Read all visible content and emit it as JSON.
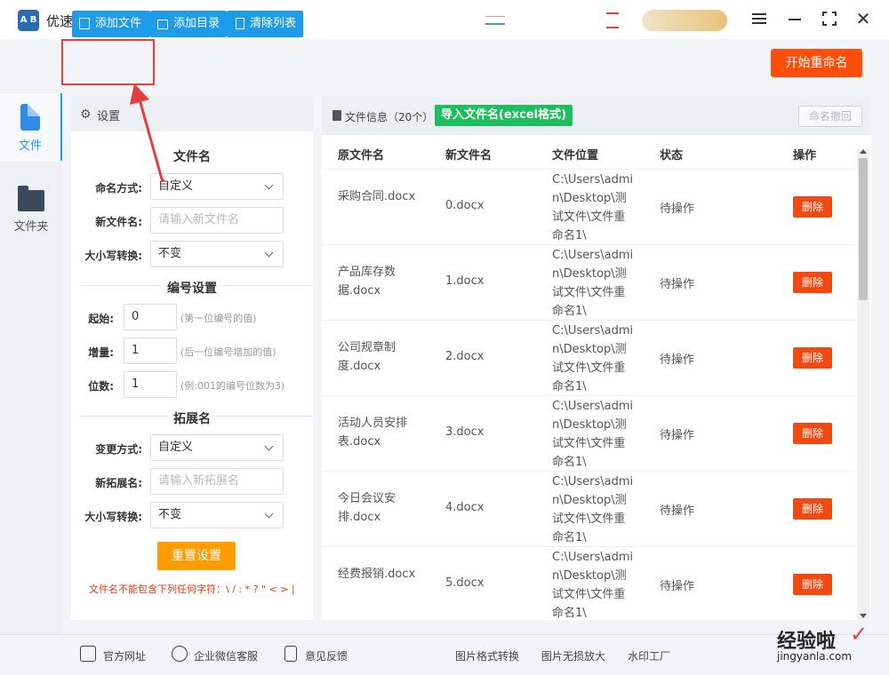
{
  "app": {
    "logo_text": "A B",
    "title": "优速文件批量重命名"
  },
  "toolbar": {
    "add_file": "添加文件",
    "add_dir": "添加目录",
    "clear_list": "清除列表",
    "start": "开始重命名"
  },
  "nav": {
    "file": "文件",
    "folder": "文件夹"
  },
  "settings": {
    "title": "设置",
    "filename_section": "文件名",
    "naming_mode_label": "命名方式:",
    "naming_mode_value": "自定义",
    "new_name_label": "新文件名:",
    "new_name_placeholder": "请输入新文件名",
    "case_label": "大小写转换:",
    "case_value": "不变",
    "numbering_section": "编号设置",
    "start_label": "起始:",
    "start_value": "0",
    "start_hint": "(第一位编号的值)",
    "step_label": "增量:",
    "step_value": "1",
    "step_hint": "(后一位编号增加的值)",
    "digits_label": "位数:",
    "digits_value": "1",
    "digits_hint": "(例:001的编号位数为3)",
    "ext_section": "拓展名",
    "ext_mode_label": "变更方式:",
    "ext_mode_value": "自定义",
    "new_ext_label": "新拓展名:",
    "new_ext_placeholder": "请输入新拓展名",
    "ext_case_label": "大小写转换:",
    "ext_case_value": "不变",
    "reset": "重置设置",
    "warning": "文件名不能包含下列任何字符：\\ / : * ? \" < > |"
  },
  "files": {
    "title": "文件信息（20个）",
    "import_btn": "导入文件名(excel格式)",
    "undo_btn": "命名撤回",
    "columns": {
      "orig": "原文件名",
      "new": "新文件名",
      "loc": "文件位置",
      "status": "状态",
      "action": "操作"
    },
    "rows": [
      {
        "orig": "采购合同.docx",
        "new": "0.docx",
        "loc": "C:\\Users\\admin\\Desktop\\测试文件\\文件重命名1\\",
        "status": "待操作",
        "action": "删除"
      },
      {
        "orig": "产品库存数据.docx",
        "new": "1.docx",
        "loc": "C:\\Users\\admin\\Desktop\\测试文件\\文件重命名1\\",
        "status": "待操作",
        "action": "删除"
      },
      {
        "orig": "公司规章制度.docx",
        "new": "2.docx",
        "loc": "C:\\Users\\admin\\Desktop\\测试文件\\文件重命名1\\",
        "status": "待操作",
        "action": "删除"
      },
      {
        "orig": "活动人员安排表.docx",
        "new": "3.docx",
        "loc": "C:\\Users\\admin\\Desktop\\测试文件\\文件重命名1\\",
        "status": "待操作",
        "action": "删除"
      },
      {
        "orig": "今日会议安排.docx",
        "new": "4.docx",
        "loc": "C:\\Users\\admin\\Desktop\\测试文件\\文件重命名1\\",
        "status": "待操作",
        "action": "删除"
      },
      {
        "orig": "经费报销.docx",
        "new": "5.docx",
        "loc": "C:\\Users\\admin\\Desktop\\测试文件\\文件重命名1\\",
        "status": "待操作",
        "action": "删除"
      }
    ]
  },
  "footer": {
    "website": "官方网址",
    "wechat": "企业微信客服",
    "feedback": "意见反馈",
    "img_convert": "图片格式转换",
    "img_enlarge": "图片无损放大",
    "watermark_factory": "水印工厂"
  },
  "watermark": {
    "main": "经验啦",
    "sub": "jingyanla.com"
  },
  "colors": {
    "primary": "#1e9be9",
    "start": "#ff4d0a",
    "import": "#1ebd5e",
    "reset": "#ff9c00",
    "delete": "#f04a12",
    "highlight": "#e53e3e"
  }
}
